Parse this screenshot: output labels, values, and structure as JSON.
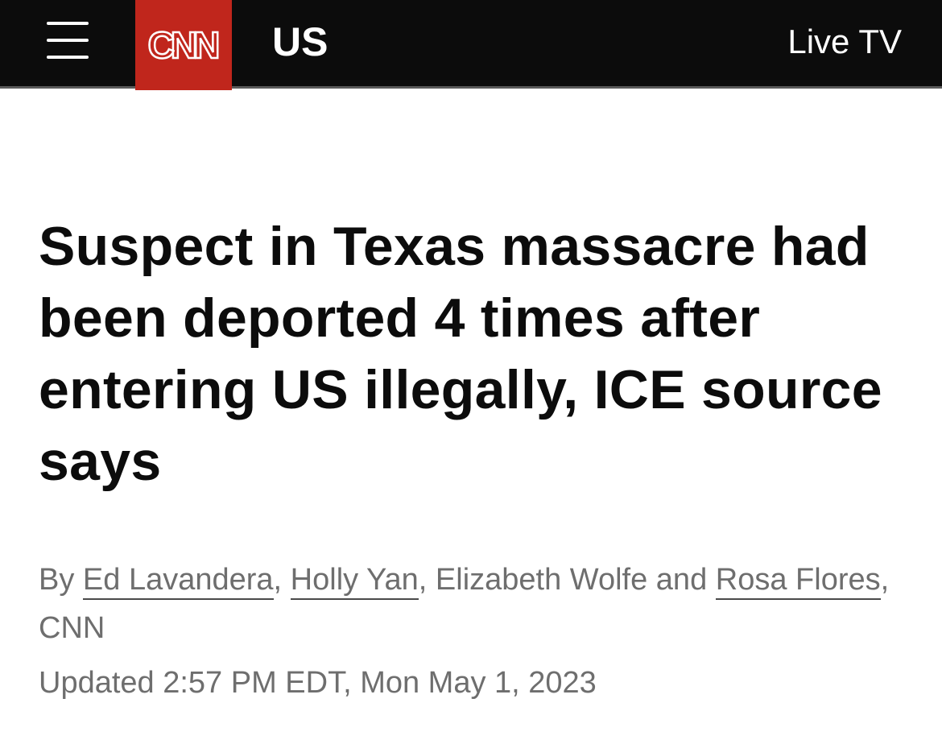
{
  "header": {
    "menu_icon": "hamburger-menu-icon",
    "logo_text": "CNN",
    "logo_color": "#c0261c",
    "section": "US",
    "live_tv": "Live TV"
  },
  "article": {
    "headline": "Suspect in Texas massacre had been deported 4 times after entering US illegally, ICE source says",
    "byline": {
      "prefix": "By ",
      "author1": "Ed Lavandera",
      "sep1": ", ",
      "author2": "Holly Yan",
      "sep2": ", Elizabeth Wolfe and ",
      "author3": "Rosa Flores",
      "suffix": ", CNN"
    },
    "updated": "Updated 2:57 PM EDT, Mon May 1, 2023"
  }
}
